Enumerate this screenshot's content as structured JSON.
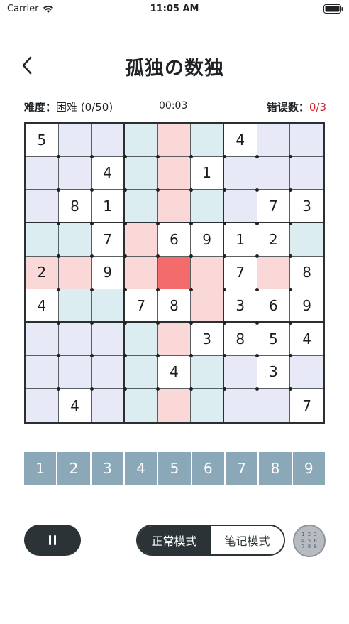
{
  "status_bar": {
    "carrier": "Carrier",
    "time": "11:05 AM"
  },
  "header": {
    "title": "孤独の数独",
    "back_icon": "chevron-left-icon"
  },
  "info": {
    "difficulty_label": "难度：",
    "difficulty_value": "困难 (0/50)",
    "timer": "00:03",
    "mistakes_label": "错误数：",
    "mistakes_value": "0/3"
  },
  "board": {
    "cells": [
      [
        "5",
        "",
        "",
        "",
        "",
        "",
        "4",
        "",
        ""
      ],
      [
        "",
        "",
        "4",
        "",
        "",
        "1",
        "",
        "",
        ""
      ],
      [
        "",
        "8",
        "1",
        "",
        "",
        "",
        "",
        "7",
        "3"
      ],
      [
        "",
        "",
        "7",
        "",
        "6",
        "9",
        "1",
        "2",
        ""
      ],
      [
        "2",
        "",
        "9",
        "",
        "",
        "",
        "7",
        "",
        "8"
      ],
      [
        "4",
        "",
        "",
        "7",
        "8",
        "",
        "3",
        "6",
        "9"
      ],
      [
        "",
        "",
        "",
        "",
        "",
        "3",
        "8",
        "5",
        "4"
      ],
      [
        "",
        "",
        "",
        "",
        "4",
        "",
        "",
        "3",
        ""
      ],
      [
        "",
        "4",
        "",
        "",
        "",
        "",
        "",
        "",
        "7"
      ]
    ],
    "highlight": [
      [
        "w",
        "l",
        "l",
        "c",
        "p",
        "c",
        "w",
        "l",
        "l"
      ],
      [
        "l",
        "l",
        "w",
        "c",
        "p",
        "w",
        "l",
        "l",
        "l"
      ],
      [
        "l",
        "w",
        "w",
        "c",
        "p",
        "c",
        "l",
        "w",
        "w"
      ],
      [
        "c",
        "c",
        "w",
        "p",
        "w",
        "w",
        "w",
        "w",
        "c"
      ],
      [
        "p",
        "p",
        "w",
        "p",
        "s",
        "p",
        "w",
        "p",
        "w"
      ],
      [
        "w",
        "c",
        "c",
        "w",
        "w",
        "p",
        "w",
        "w",
        "w"
      ],
      [
        "l",
        "l",
        "l",
        "c",
        "p",
        "w",
        "w",
        "w",
        "w"
      ],
      [
        "l",
        "l",
        "l",
        "c",
        "w",
        "c",
        "l",
        "w",
        "l"
      ],
      [
        "l",
        "w",
        "l",
        "c",
        "p",
        "c",
        "l",
        "l",
        "w"
      ]
    ],
    "colors": {
      "lavender": "#e7eaf6",
      "cyan": "#dcedf2",
      "pink": "#fbd8d8",
      "selected": "#f46b6b"
    }
  },
  "numpad": {
    "keys": [
      "1",
      "2",
      "3",
      "4",
      "5",
      "6",
      "7",
      "8",
      "9"
    ],
    "color": "#8ba8b9"
  },
  "controls": {
    "pause_icon": "pause-icon",
    "mode_normal": "正常模式",
    "mode_notes": "笔记模式",
    "notes_grid_digits": [
      "1",
      "2",
      "3",
      "4",
      "5",
      "6",
      "7",
      "8",
      "9"
    ]
  }
}
